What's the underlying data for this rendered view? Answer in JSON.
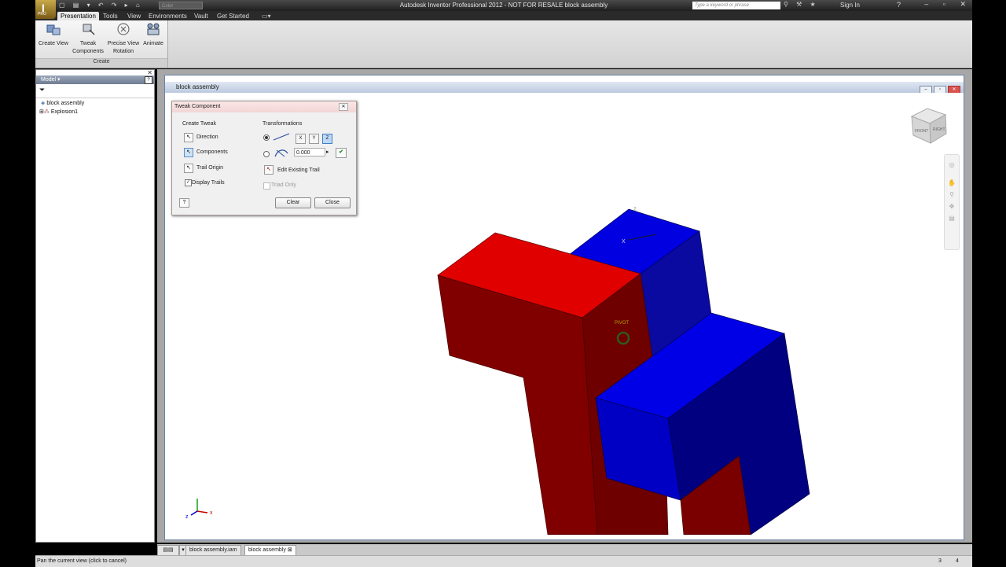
{
  "app": {
    "title": "Autodesk Inventor Professional 2012 - NOT FOR RESALE   block assembly",
    "pro_label": "PRO",
    "color_placeholder": "Color",
    "search_placeholder": "Type a keyword or phrase",
    "sign_in": "Sign In"
  },
  "ribbon": {
    "tabs": [
      "Presentation",
      "Tools",
      "View",
      "Environments",
      "Vault",
      "Get Started"
    ],
    "active_tab": "Presentation",
    "buttons": [
      {
        "label1": "Create View",
        "label2": ""
      },
      {
        "label1": "Tweak",
        "label2": "Components"
      },
      {
        "label1": "Precise View",
        "label2": "Rotation"
      },
      {
        "label1": "Animate",
        "label2": ""
      }
    ],
    "panel_label": "Create"
  },
  "browser": {
    "header": "Model",
    "help": "?",
    "tree": [
      "block assembly",
      "Explosion1"
    ]
  },
  "document": {
    "title": "block assembly"
  },
  "dialog": {
    "title": "Tweak Component",
    "create_tweak": "Create Tweak",
    "direction": "Direction",
    "components": "Components",
    "trail_origin": "Trail Origin",
    "display_trails": "Display Trails",
    "transformations": "Transformations",
    "axes": [
      "X",
      "Y",
      "Z"
    ],
    "value": "0.000",
    "edit_existing_trail": "Edit Existing Trail",
    "triad_only": "Triad Only",
    "clear": "Clear",
    "close": "Close"
  },
  "viewport": {
    "pivot_label": "PIVOT",
    "triad_x": "X",
    "triad_z": "Z",
    "viewcube_front": "FRONT",
    "viewcube_right": "RIGHT",
    "axis_x": "x",
    "axis_z": "z",
    "red": "#c40000",
    "blue": "#0000d8"
  },
  "doc_tabs": [
    "block assembly.iam",
    "block assembly"
  ],
  "status": {
    "message": "Pan the current view (click to cancel)",
    "n1": "3",
    "n2": "4"
  }
}
